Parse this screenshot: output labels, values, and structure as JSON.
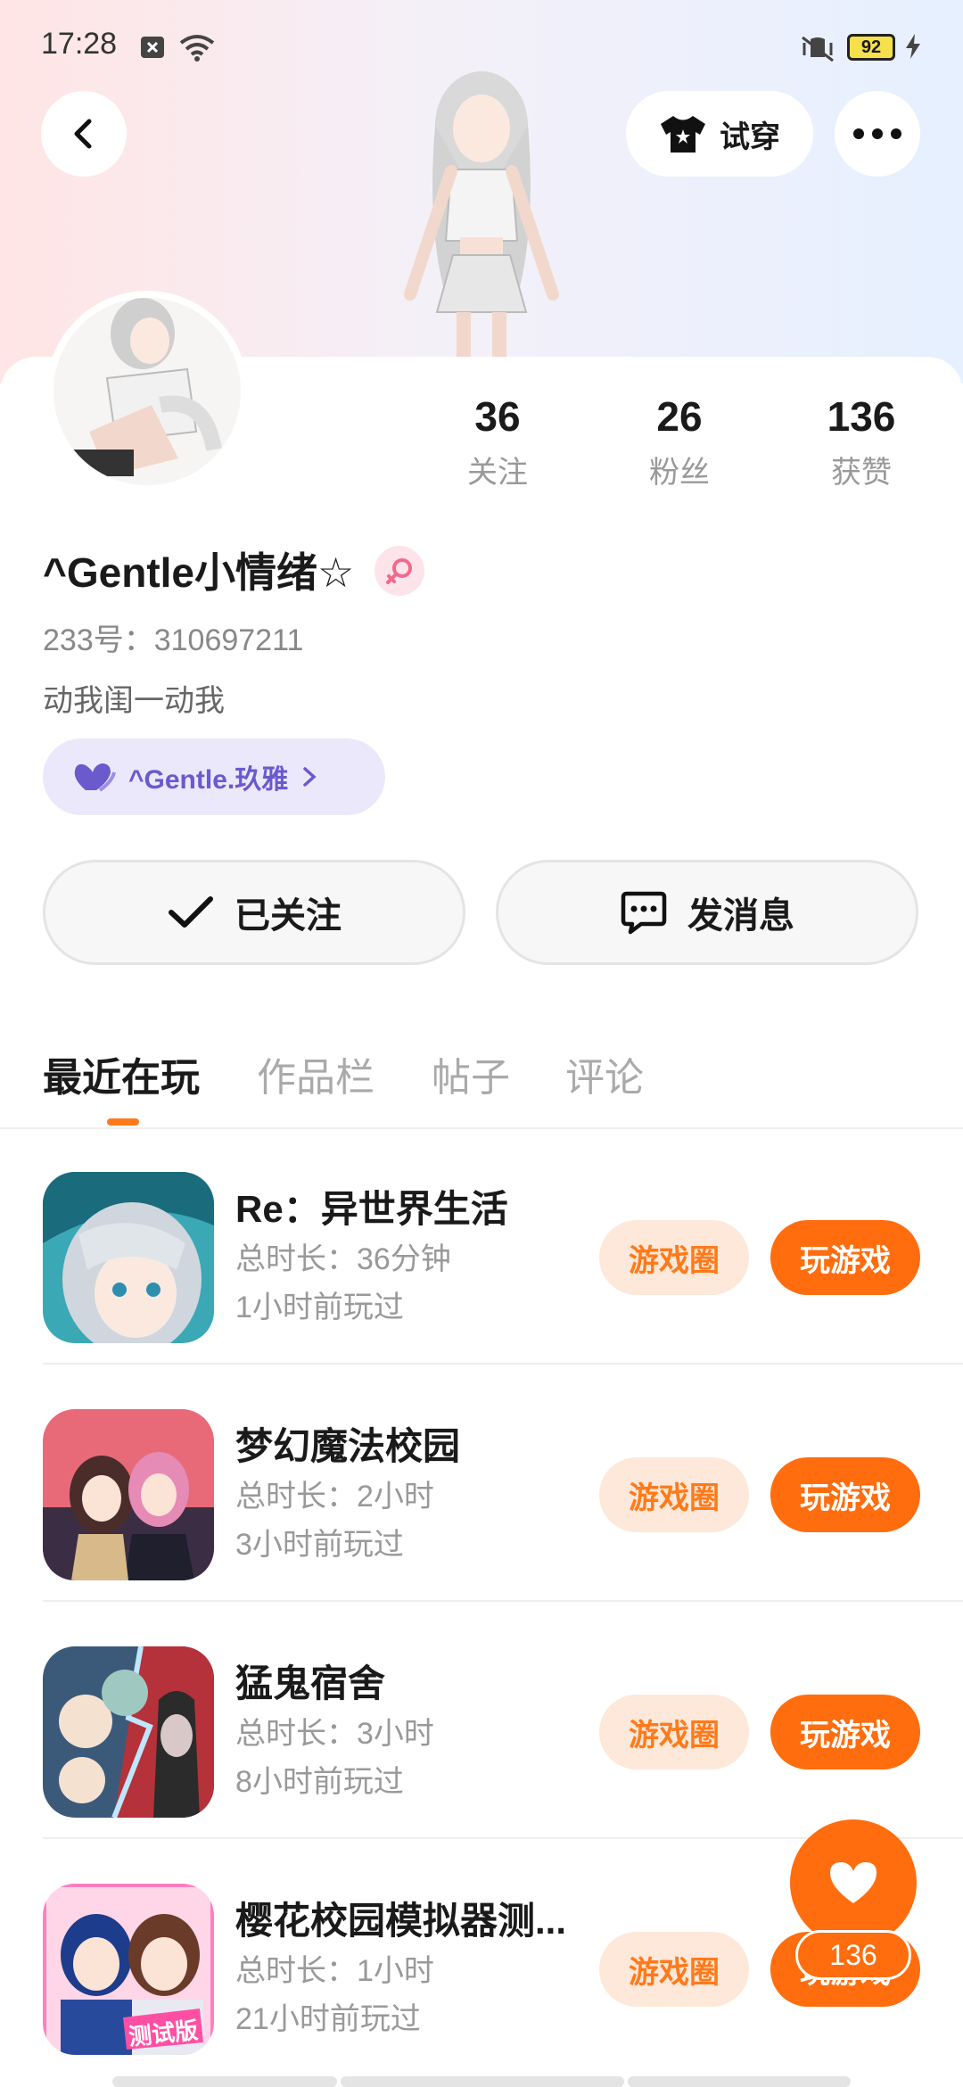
{
  "status_bar": {
    "time": "17:28",
    "battery": "92"
  },
  "header": {
    "try_on_label": "试穿"
  },
  "profile": {
    "name": "^Gentle小情绪☆",
    "uid": "233号：310697211",
    "bio": "动我闺一动我",
    "cp_name": "^Gentle.玖雅",
    "stats": [
      {
        "num": "36",
        "label": "关注"
      },
      {
        "num": "26",
        "label": "粉丝"
      },
      {
        "num": "136",
        "label": "获赞"
      }
    ]
  },
  "actions": {
    "follow_label": "已关注",
    "message_label": "发消息"
  },
  "tabs": [
    "最近在玩",
    "作品栏",
    "帖子",
    "评论"
  ],
  "games": [
    {
      "name": "Re：异世界生活",
      "duration": "总时长：36分钟",
      "last_played": "1小时前玩过",
      "circle": "游戏圈",
      "play": "玩游戏"
    },
    {
      "name": "梦幻魔法校园",
      "duration": "总时长：2小时",
      "last_played": "3小时前玩过",
      "circle": "游戏圈",
      "play": "玩游戏"
    },
    {
      "name": "猛鬼宿舍",
      "duration": "总时长：3小时",
      "last_played": "8小时前玩过",
      "circle": "游戏圈",
      "play": "玩游戏"
    },
    {
      "name": "樱花校园模拟器测...",
      "duration": "总时长：1小时",
      "last_played": "21小时前玩过",
      "circle": "游戏圈",
      "play": "玩游戏"
    }
  ],
  "like_fab": {
    "count": "136"
  },
  "game_icon_badge": "测试版",
  "colors": {
    "accent": "#ff6d0e",
    "accent_light": "#fde8da",
    "cp_bg": "#ebe8fb",
    "cp_text": "#6a5acd"
  }
}
